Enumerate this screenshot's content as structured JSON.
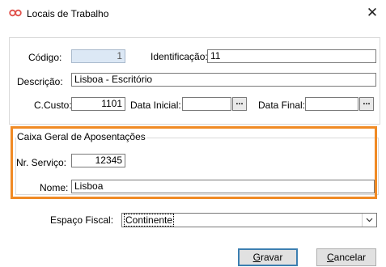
{
  "window": {
    "title": "Locais de Trabalho",
    "close_symbol": "✕"
  },
  "form": {
    "codigo": {
      "label": "Código:",
      "value": "1"
    },
    "identificacao": {
      "label": "Identificação:",
      "value": "11"
    },
    "descricao": {
      "label": "Descrição:",
      "value": "Lisboa - Escritório"
    },
    "ccusto": {
      "label": "C.Custo:",
      "value": "1101"
    },
    "data_inicial": {
      "label": "Data Inicial:",
      "value": "",
      "button_label": "..."
    },
    "data_final": {
      "label": "Data Final:",
      "value": "",
      "button_label": "..."
    }
  },
  "group": {
    "title": "Caixa Geral de Aposentações",
    "nr_servico": {
      "label": "Nr. Serviço:",
      "value": "12345"
    },
    "nome": {
      "label": "Nome:",
      "value": "Lisboa"
    }
  },
  "espaco_fiscal": {
    "label": "Espaço Fiscal:",
    "selected": "Continente"
  },
  "buttons": {
    "gravar": {
      "first": "G",
      "rest": "ravar"
    },
    "cancelar": {
      "first": "C",
      "rest": "ancelar"
    }
  },
  "colors": {
    "highlight": "#f08a24",
    "default_button_border": "#3c7fb1",
    "disabled_field": "#dce8f5",
    "app_icon": "#e0504a"
  },
  "icons": {
    "app": "infinity-icon",
    "close": "close-icon",
    "dropdown": "chevron-down-icon"
  }
}
